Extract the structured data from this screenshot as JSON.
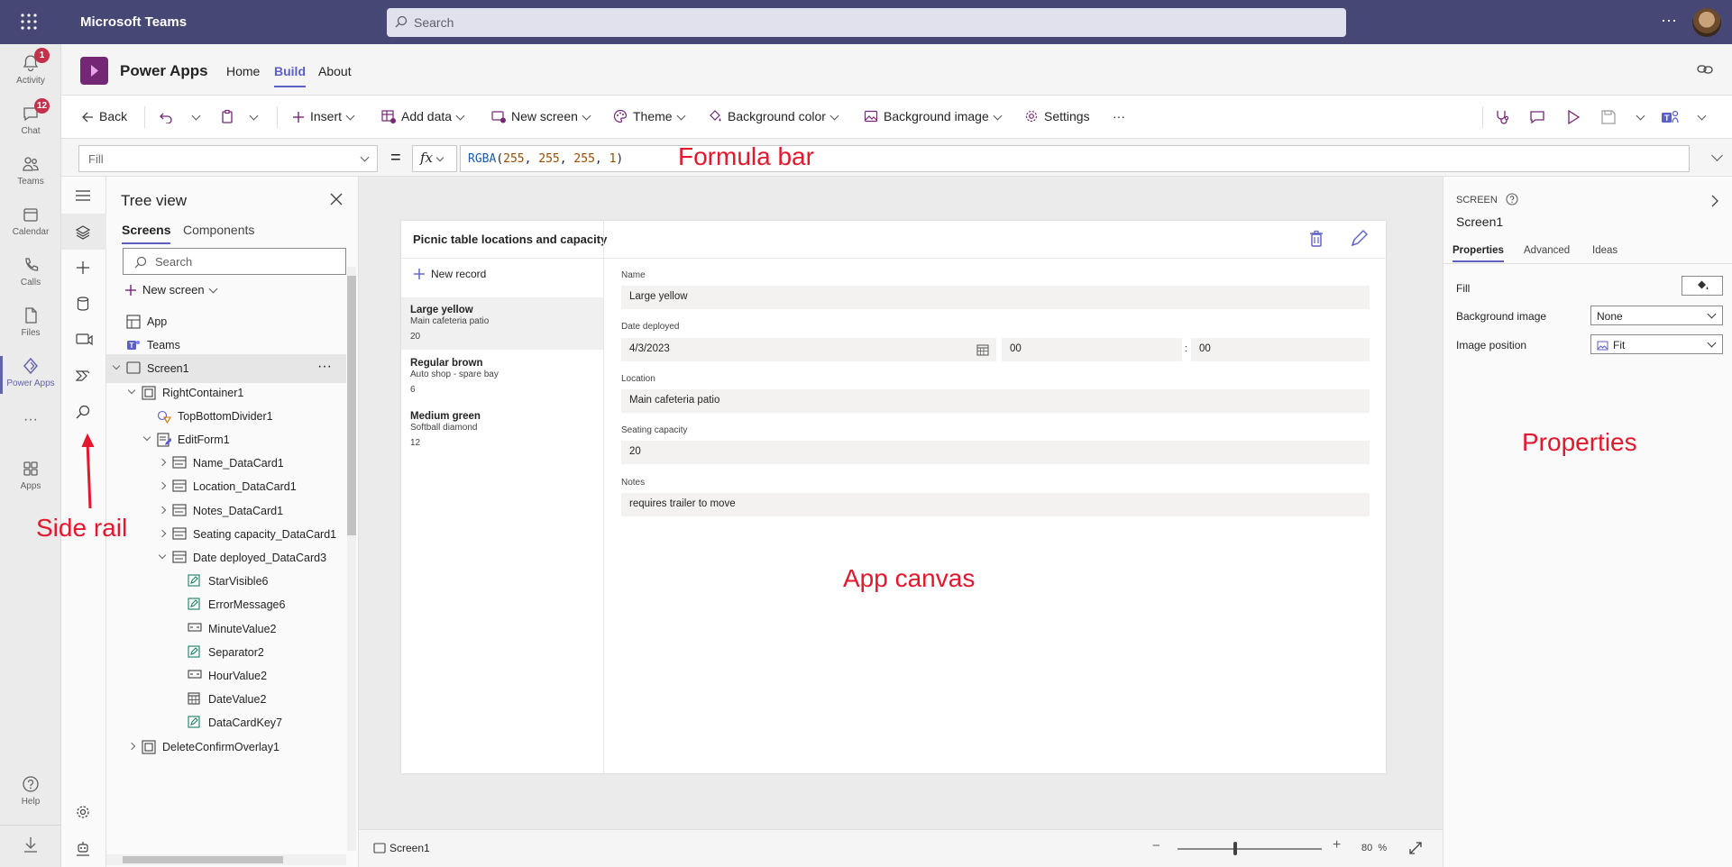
{
  "teams": {
    "title": "Microsoft Teams",
    "search_placeholder": "Search",
    "more": "···",
    "rail": [
      {
        "label": "Activity",
        "badge": "1"
      },
      {
        "label": "Chat",
        "badge": "12"
      },
      {
        "label": "Teams"
      },
      {
        "label": "Calendar"
      },
      {
        "label": "Calls"
      },
      {
        "label": "Files"
      },
      {
        "label": "Power Apps"
      },
      {
        "label": "···"
      },
      {
        "label": "Apps"
      },
      {
        "label": "Help"
      }
    ]
  },
  "app": {
    "name": "Power Apps",
    "tabs": [
      "Home",
      "Build",
      "About"
    ]
  },
  "toolbar": {
    "back": "Back",
    "insert": "Insert",
    "add_data": "Add data",
    "new_screen": "New screen",
    "theme": "Theme",
    "background_color": "Background color",
    "background_image": "Background image",
    "settings": "Settings",
    "more": "···"
  },
  "formula": {
    "property": "Fill",
    "equals": "=",
    "fx": "fx",
    "fn": "RGBA",
    "open": "(",
    "args": [
      "255",
      "255",
      "255",
      "1"
    ],
    "close": ")"
  },
  "annotations": {
    "formula_bar": "Formula bar",
    "side_rail": "Side rail",
    "app_canvas": "App canvas",
    "properties": "Properties"
  },
  "tree": {
    "title": "Tree view",
    "tabs": [
      "Screens",
      "Components"
    ],
    "search_placeholder": "Search",
    "new_screen": "New screen",
    "nodes": [
      {
        "label": "App",
        "indent": 0,
        "icon": "app"
      },
      {
        "label": "Teams",
        "indent": 0,
        "icon": "teams"
      },
      {
        "label": "Screen1",
        "indent": 0,
        "icon": "screen",
        "open": true,
        "selected": true
      },
      {
        "label": "RightContainer1",
        "indent": 1,
        "icon": "container",
        "open": true
      },
      {
        "label": "TopBottomDivider1",
        "indent": 2,
        "icon": "shape"
      },
      {
        "label": "EditForm1",
        "indent": 2,
        "icon": "form",
        "open": true
      },
      {
        "label": "Name_DataCard1",
        "indent": 3,
        "icon": "card",
        "closed": true
      },
      {
        "label": "Location_DataCard1",
        "indent": 3,
        "icon": "card",
        "closed": true
      },
      {
        "label": "Notes_DataCard1",
        "indent": 3,
        "icon": "card",
        "closed": true
      },
      {
        "label": "Seating capacity_DataCard1",
        "indent": 3,
        "icon": "card",
        "closed": true
      },
      {
        "label": "Date deployed_DataCard3",
        "indent": 3,
        "icon": "card",
        "open": true
      },
      {
        "label": "StarVisible6",
        "indent": 4,
        "icon": "label"
      },
      {
        "label": "ErrorMessage6",
        "indent": 4,
        "icon": "label"
      },
      {
        "label": "MinuteValue2",
        "indent": 4,
        "icon": "dropdown"
      },
      {
        "label": "Separator2",
        "indent": 4,
        "icon": "label"
      },
      {
        "label": "HourValue2",
        "indent": 4,
        "icon": "dropdown"
      },
      {
        "label": "DateValue2",
        "indent": 4,
        "icon": "date"
      },
      {
        "label": "DataCardKey7",
        "indent": 4,
        "icon": "label"
      },
      {
        "label": "DeleteConfirmOverlay1",
        "indent": 1,
        "icon": "container",
        "closed": true
      }
    ]
  },
  "screen": {
    "title": "Picnic table locations and capacity",
    "new_record": "New record",
    "gallery": [
      {
        "title": "Large yellow",
        "subtitle": "Main cafeteria patio",
        "capacity": "20"
      },
      {
        "title": "Regular brown",
        "subtitle": "Auto shop - spare bay",
        "capacity": "6"
      },
      {
        "title": "Medium green",
        "subtitle": "Softball diamond",
        "capacity": "12"
      }
    ],
    "form": {
      "name_label": "Name",
      "name_value": "Large yellow",
      "date_label": "Date deployed",
      "date_value": "4/3/2023",
      "hour": "00",
      "colon": ":",
      "minute": "00",
      "location_label": "Location",
      "location_value": "Main cafeteria patio",
      "seating_label": "Seating capacity",
      "seating_value": "20",
      "notes_label": "Notes",
      "notes_value": "requires trailer to move"
    }
  },
  "footer": {
    "screen": "Screen1",
    "zoom": "80",
    "percent": "%",
    "zoom_fraction": 0.4
  },
  "props": {
    "type": "SCREEN",
    "name": "Screen1",
    "tabs": [
      "Properties",
      "Advanced",
      "Ideas"
    ],
    "fill_label": "Fill",
    "bgimage_label": "Background image",
    "bgimage_value": "None",
    "imgpos_label": "Image position",
    "imgpos_value": "Fit"
  },
  "colors": {
    "teams_bar": "#464775",
    "accent": "#5b5fc7",
    "powerapps_logo": "#742774",
    "annotation": "#e3182d"
  }
}
